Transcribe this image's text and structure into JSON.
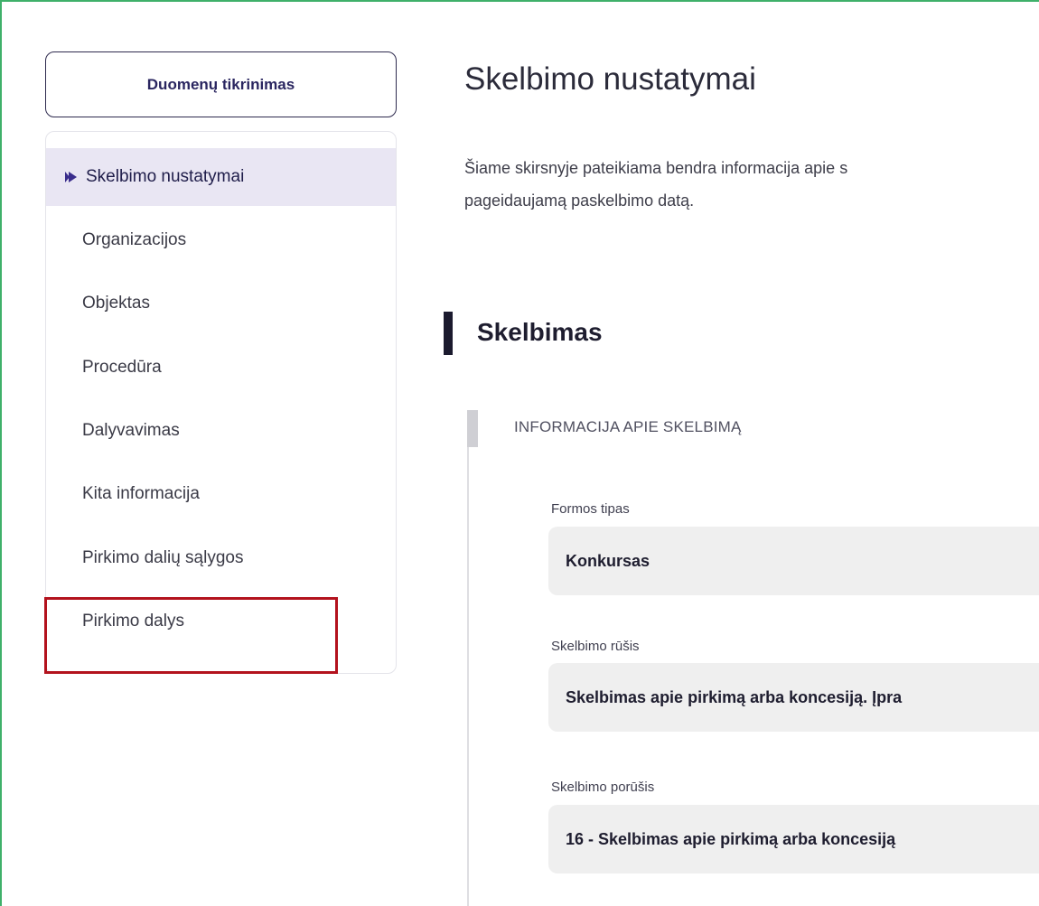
{
  "sidebar": {
    "check_button": "Duomenų tikrinimas",
    "items": [
      {
        "label": "Skelbimo nustatymai",
        "active": true
      },
      {
        "label": "Organizacijos"
      },
      {
        "label": "Objektas"
      },
      {
        "label": "Procedūra"
      },
      {
        "label": "Dalyvavimas"
      },
      {
        "label": "Kita informacija"
      },
      {
        "label": "Pirkimo dalių sąlygos"
      },
      {
        "label": "Pirkimo dalys"
      }
    ]
  },
  "main": {
    "title": "Skelbimo nustatymai",
    "intro_line1": "Šiame skirsnyje pateikiama bendra informacija apie s",
    "intro_line2": "pageidaujamą paskelbimo datą.",
    "section_title": "Skelbimas",
    "subsection_title": "INFORMACIJA APIE SKELBIMĄ",
    "fields": [
      {
        "label": "Formos tipas",
        "value": "Konkursas"
      },
      {
        "label": "Skelbimo rūšis",
        "value": "Skelbimas apie pirkimą arba koncesiją. Įpra"
      },
      {
        "label": "Skelbimo porūšis",
        "value": "16 - Skelbimas apie pirkimą arba koncesiją"
      }
    ]
  },
  "colors": {
    "accent": "#2a2660",
    "active_bg": "#e9e6f3",
    "highlight": "#b3121d",
    "frame": "#3fb06a"
  }
}
